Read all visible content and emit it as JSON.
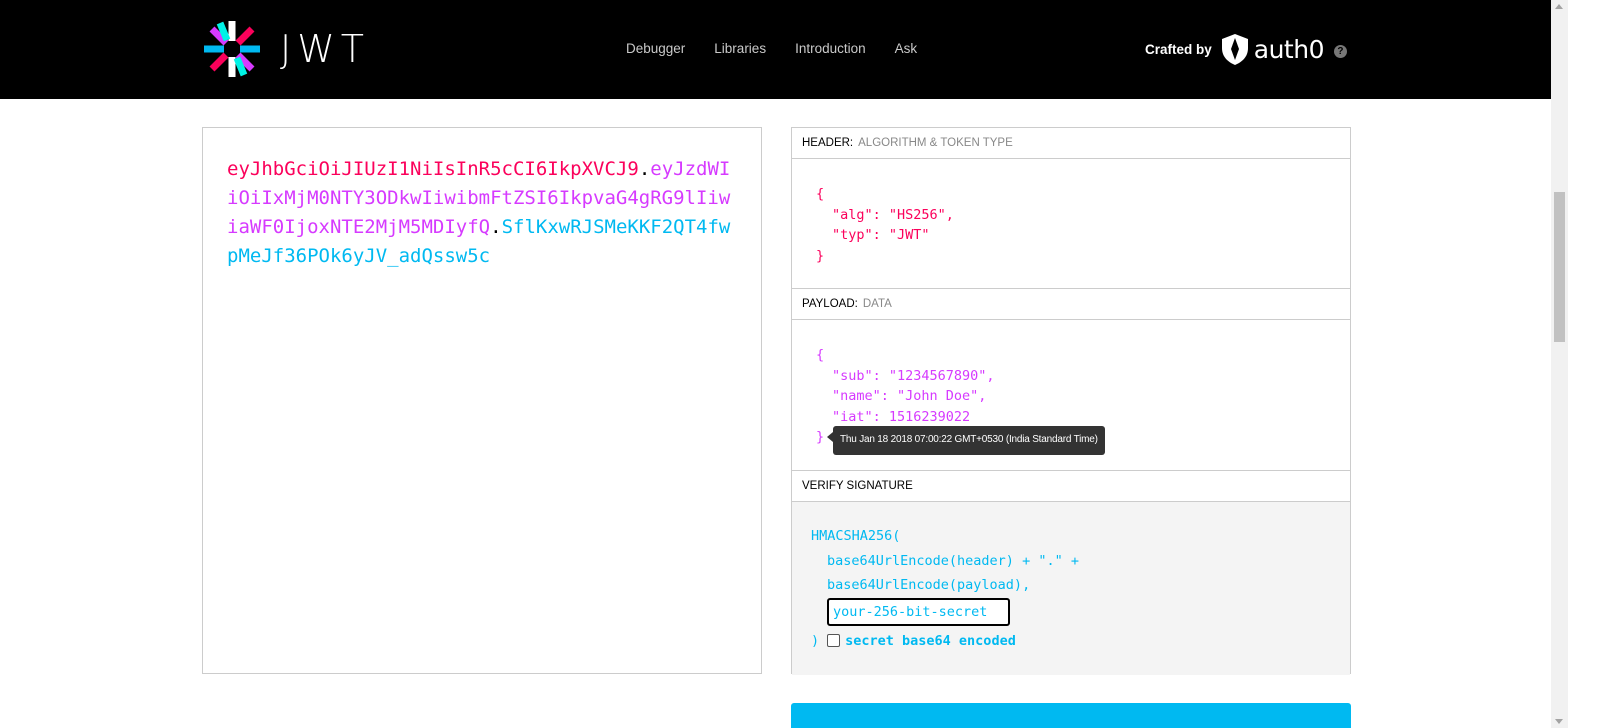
{
  "nav": {
    "logo_text": "JWT",
    "links": [
      "Debugger",
      "Libraries",
      "Introduction",
      "Ask"
    ],
    "crafted_by": "Crafted by",
    "brand": "auth0",
    "help": "?"
  },
  "encoded": {
    "header": "eyJhbGciOiJIUzI1NiIsInR5cCI6IkpXVCJ9",
    "payload": "eyJzdWIiOiIxMjM0NTY3ODkwIiwibmFtZSI6IkpvaG4gRG9lIiwiaWF0IjoxNTE2MjM5MDIyfQ",
    "signature": "SflKxwRJSMeKKF2QT4fwpMeJf36POk6yJV_adQssw5c",
    "dot": "."
  },
  "header_section": {
    "title": "HEADER:",
    "subtitle": "ALGORITHM & TOKEN TYPE",
    "open": "{",
    "lines": [
      "\"alg\": \"HS256\",",
      "\"typ\": \"JWT\""
    ],
    "close": "}"
  },
  "payload_section": {
    "title": "PAYLOAD:",
    "subtitle": "DATA",
    "open": "{",
    "lines": [
      "\"sub\": \"1234567890\",",
      "\"name\": \"John Doe\",",
      "\"iat\": 1516239022"
    ],
    "close": "}",
    "tooltip": "Thu Jan 18 2018 07:00:22 GMT+0530 (India Standard Time)"
  },
  "verify_section": {
    "title": "VERIFY SIGNATURE",
    "fn": "HMACSHA256(",
    "line1": "base64UrlEncode(header) + \".\" +",
    "line2": "base64UrlEncode(payload),",
    "secret_value": "your-256-bit-secret",
    "close": ")",
    "checkbox_label": "secret base64 encoded"
  },
  "colors": {
    "header": "#fb015b",
    "payload": "#d63aff",
    "signature": "#00b9f1"
  }
}
